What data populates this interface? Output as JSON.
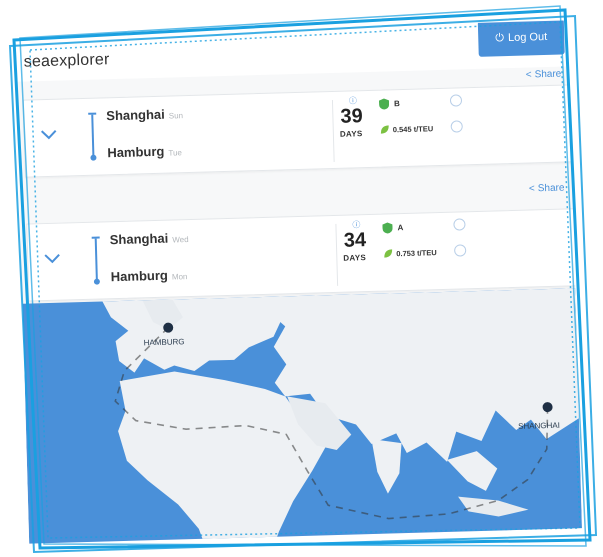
{
  "app": {
    "brand": "seaexplorer"
  },
  "header": {
    "logout_label": "Log Out"
  },
  "routes": [
    {
      "share_label": "Share",
      "origin": "Shanghai",
      "origin_day": "Sun",
      "destination": "Hamburg",
      "destination_day": "Tue",
      "info_marker": "ⓘ",
      "days": "39",
      "days_label": "DAYS",
      "grade": "B",
      "co2": "0.545 t/TEU"
    },
    {
      "share_label": "Share",
      "origin": "Shanghai",
      "origin_day": "Wed",
      "destination": "Hamburg",
      "destination_day": "Mon",
      "info_marker": "ⓘ",
      "days": "34",
      "days_label": "DAYS",
      "grade": "A",
      "co2": "0.753 t/TEU"
    }
  ],
  "map": {
    "labels": {
      "hamburg": "HAMBURG",
      "shanghai": "SHANGHAI"
    }
  },
  "colors": {
    "accent": "#4a90d9",
    "sea": "#4a90d9",
    "land": "#eef1f4",
    "grade_shield": "#4caf50",
    "leaf": "#7cc142"
  }
}
